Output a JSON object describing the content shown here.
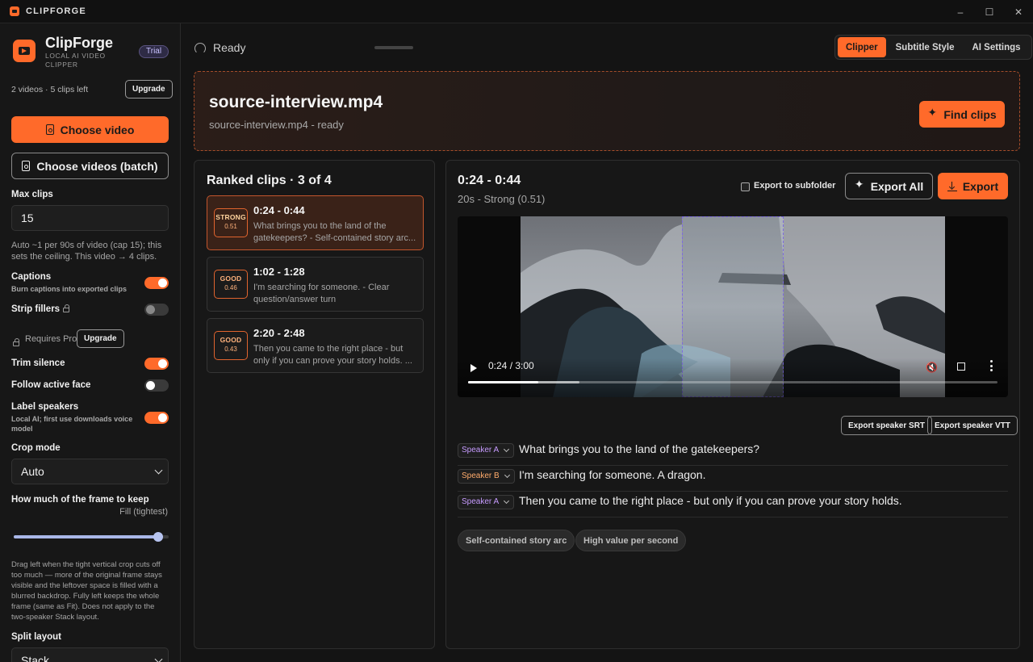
{
  "window": {
    "title": "CLIPFORGE",
    "controls": [
      "–",
      "☐",
      "✕"
    ]
  },
  "sidebar": {
    "app_name": "ClipForge",
    "app_tagline": "LOCAL AI VIDEO CLIPPER",
    "plan_badge": "Trial",
    "usage": "2 videos · 5 clips left",
    "upgrade_label": "Upgrade",
    "choose_video_label": "Choose video",
    "choose_batch_label": "Choose videos (batch)",
    "max_clips": {
      "label": "Max clips",
      "value": "15",
      "help": "Auto ~1 per 90s of video (cap 15); this sets the ceiling. This video → 4 clips."
    },
    "captions": {
      "label": "Captions",
      "sub": "Burn captions into exported clips",
      "on": true
    },
    "strip_fillers": {
      "label": "Strip fillers",
      "on": false
    },
    "requires_pro": "Requires Pro",
    "upgrade2_label": "Upgrade",
    "trim_silence": {
      "label": "Trim silence",
      "on": true
    },
    "follow_face": {
      "label": "Follow active face",
      "on": false
    },
    "label_speakers": {
      "label": "Label speakers",
      "sub": "Local AI; first use downloads voice model",
      "on": true
    },
    "crop_mode": {
      "label": "Crop mode",
      "value": "Auto"
    },
    "frame_keep": {
      "label": "How much of the frame to keep",
      "value_label": "Fill (tightest)",
      "value_fraction": 0.93,
      "help": "Drag left when the tight vertical crop cuts off too much — more of the original frame stays visible and the leftover space is filled with a blurred backdrop. Fully left keeps the whole frame (same as Fit). Does not apply to the two-speaker Stack layout."
    },
    "split_layout": {
      "label": "Split layout",
      "value": "Stack"
    }
  },
  "header": {
    "status": "Ready",
    "tabs": [
      {
        "label": "Clipper",
        "active": true
      },
      {
        "label": "Subtitle Style",
        "active": false
      },
      {
        "label": "AI Settings",
        "active": false
      }
    ]
  },
  "source": {
    "filename": "source-interview.mp4",
    "status_line": "source-interview.mp4 - ready",
    "find_label": "Find clips"
  },
  "ranked": {
    "title": "Ranked clips · 3 of 4",
    "clips": [
      {
        "grade": "STRONG",
        "score": "0.51",
        "range": "0:24 - 0:44",
        "text": "What brings you to the land of the gatekeepers? - Self-contained story arc...",
        "selected": true
      },
      {
        "grade": "GOOD",
        "score": "0.46",
        "range": "1:02 - 1:28",
        "text": "I'm searching for someone. - Clear question/answer turn",
        "selected": false
      },
      {
        "grade": "GOOD",
        "score": "0.43",
        "range": "2:20 - 2:48",
        "text": "Then you came to the right place - but only if you can prove your story holds. ...",
        "selected": false
      }
    ]
  },
  "preview": {
    "range": "0:24 - 0:44",
    "meta": "20s - Strong (0.51)",
    "subfolder_label": "Export to subfolder",
    "subfolder_checked": false,
    "export_all_label": "Export All",
    "export_label": "Export",
    "player": {
      "time": "0:24 / 3:00",
      "played_fraction": 0.133,
      "buffered_fraction": 0.21
    },
    "srt_label": "Export speaker SRT",
    "vtt_label": "Export speaker VTT",
    "transcript": [
      {
        "speaker": "Speaker A",
        "speaker_color": "#c79bff",
        "text": "What brings you to the land of the gatekeepers?"
      },
      {
        "speaker": "Speaker B",
        "speaker_color": "#ffab6b",
        "text": "I'm searching for someone. A dragon."
      },
      {
        "speaker": "Speaker A",
        "speaker_color": "#c79bff",
        "text": "Then you came to the right place - but only if you can prove your story holds."
      }
    ],
    "tags": [
      "Self-contained story arc",
      "High value per second"
    ]
  },
  "colors": {
    "accent": "#ff6a2a",
    "crop_outline": "#7d6ae0"
  }
}
